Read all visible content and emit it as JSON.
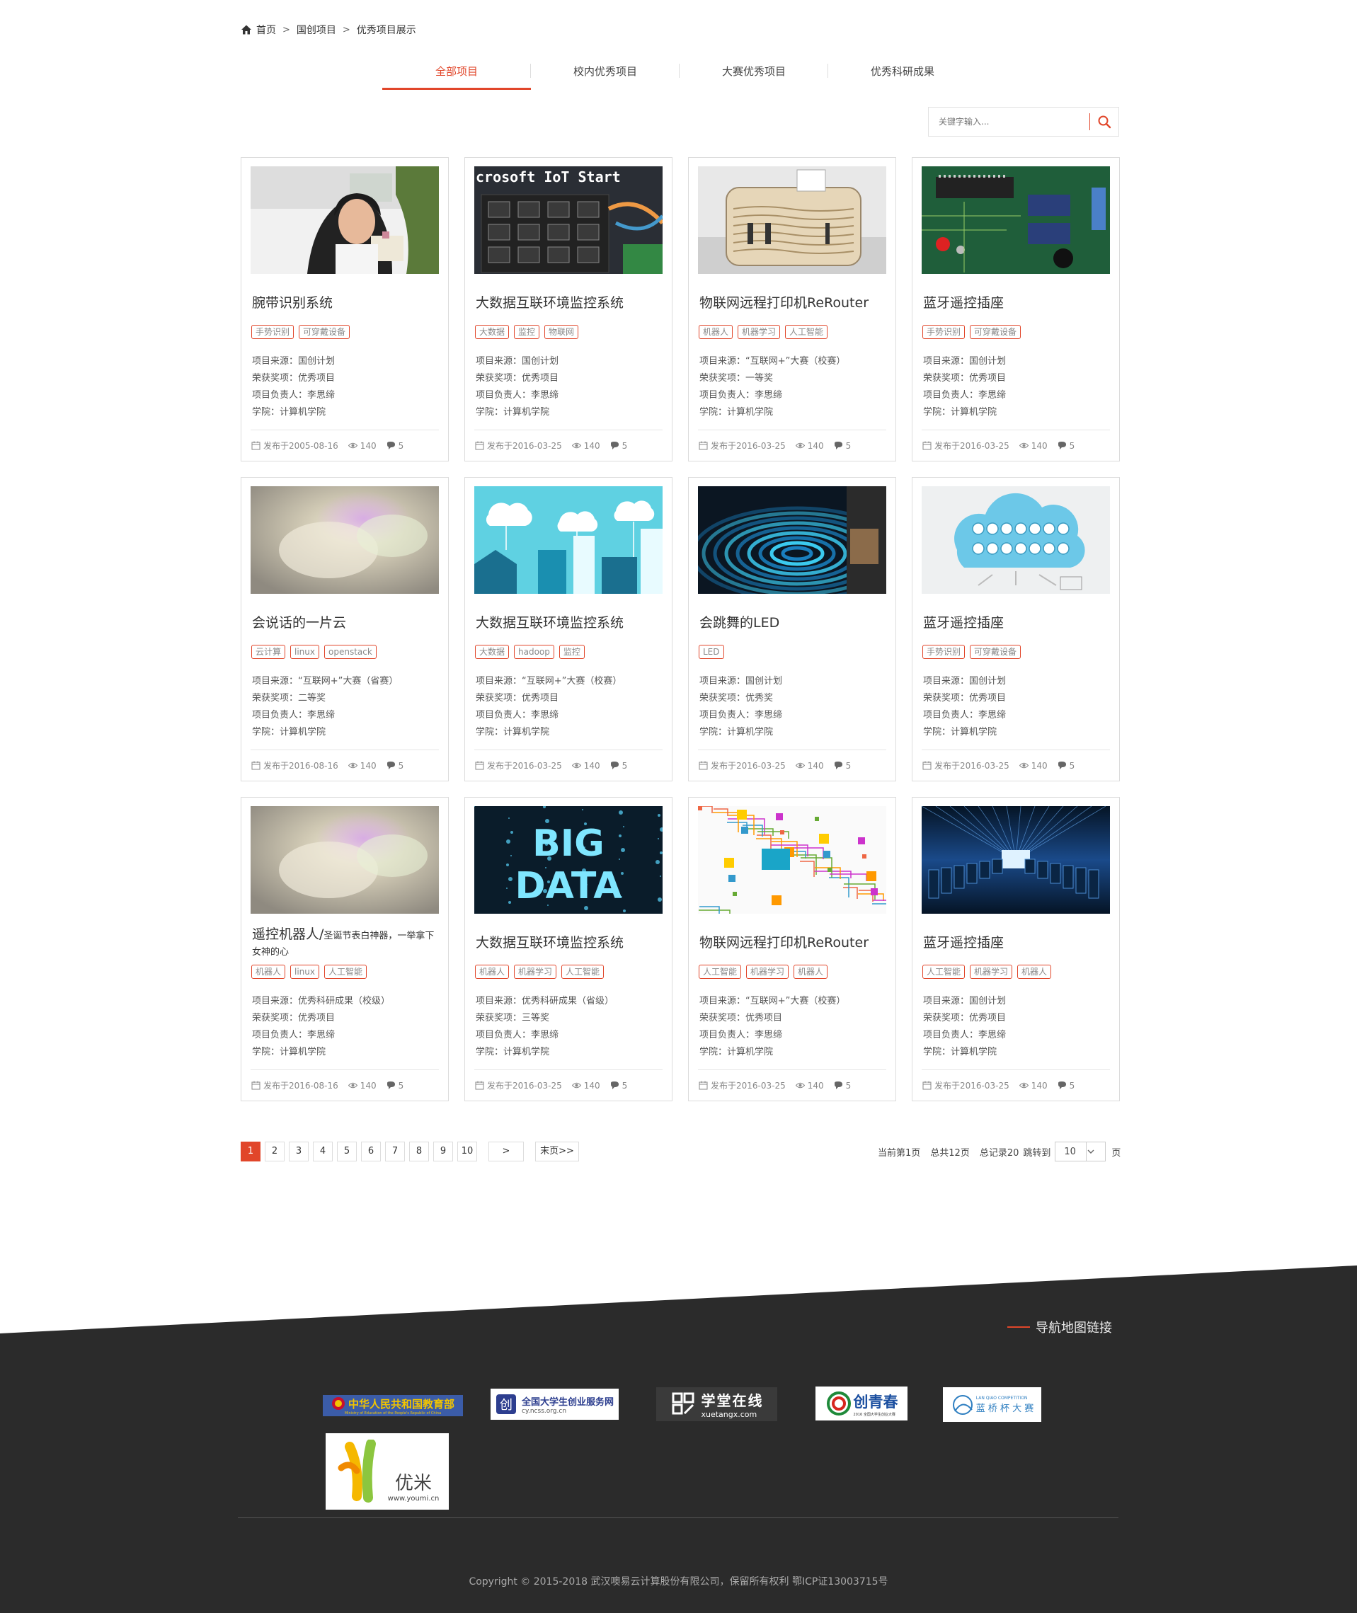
{
  "breadcrumb": {
    "items": [
      "首页",
      "国创项目",
      "优秀项目展示"
    ],
    "sep": ">"
  },
  "tabs": [
    "全部项目",
    "校内优秀项目",
    "大赛优秀项目",
    "优秀科研成果"
  ],
  "search": {
    "placeholder": "关键字输入..."
  },
  "labels": {
    "source": "项目来源：",
    "award": "荣获奖项：",
    "owner": "项目负责人：",
    "college": "学院："
  },
  "cards": [
    {
      "title": "腕带识别系统",
      "tags": [
        "手势识别",
        "可穿戴设备"
      ],
      "source": "国创计划",
      "award": "优秀项目",
      "owner": "李思缔",
      "college": "计算机学院",
      "date": "发布于2005-08-16",
      "views": "140",
      "comments": "5",
      "image": "woman-photo"
    },
    {
      "title": "大数据互联环境监控系统",
      "tags": [
        "大数据",
        "监控",
        "物联网"
      ],
      "source": "国创计划",
      "award": "优秀项目",
      "owner": "李思缔",
      "college": "计算机学院",
      "date": "发布于2016-03-25",
      "views": "140",
      "comments": "5",
      "image": "iot-board"
    },
    {
      "title": "物联网远程打印机ReRouter",
      "tags": [
        "机器人",
        "机器学习",
        "人工智能"
      ],
      "source": "“互联网+”大赛（校赛）",
      "award": "一等奖",
      "owner": "李思缔",
      "college": "计算机学院",
      "date": "发布于2016-03-25",
      "views": "140",
      "comments": "5",
      "image": "printer"
    },
    {
      "title": "蓝牙遥控插座",
      "tags": [
        "手势识别",
        "可穿戴设备"
      ],
      "source": "国创计划",
      "award": "优秀项目",
      "owner": "李思缔",
      "college": "计算机学院",
      "date": "发布于2016-03-25",
      "views": "140",
      "comments": "5",
      "image": "circuit-board"
    },
    {
      "title": "会说话的一片云",
      "tags": [
        "云计算",
        "linux",
        "openstack"
      ],
      "source": "“互联网+”大赛（省赛）",
      "award": "二等奖",
      "owner": "李思缔",
      "college": "计算机学院",
      "date": "发布于2016-08-16",
      "views": "140",
      "comments": "5",
      "image": "cloud-lamp"
    },
    {
      "title": "大数据互联环境监控系统",
      "tags": [
        "大数据",
        "hadoop",
        "监控"
      ],
      "source": "“互联网+”大赛（校赛）",
      "award": "优秀项目",
      "owner": "李思缔",
      "college": "计算机学院",
      "date": "发布于2016-03-25",
      "views": "140",
      "comments": "5",
      "image": "cloud-city"
    },
    {
      "title": "会跳舞的LED",
      "tags": [
        "LED"
      ],
      "source": "国创计划",
      "award": "优秀奖",
      "owner": "李思缔",
      "college": "计算机学院",
      "date": "发布于2016-03-25",
      "views": "140",
      "comments": "5",
      "image": "led-rings"
    },
    {
      "title": "蓝牙遥控插座",
      "tags": [
        "手势识别",
        "可穿戴设备"
      ],
      "source": "国创计划",
      "award": "优秀项目",
      "owner": "李思缔",
      "college": "计算机学院",
      "date": "发布于2016-03-25",
      "views": "140",
      "comments": "5",
      "image": "cloud-icons"
    },
    {
      "title": "遥控机器人/",
      "title_sub": "圣诞节表白神器，一举拿下女神的心",
      "tags": [
        "机器人",
        "linux",
        "人工智能"
      ],
      "source": "优秀科研成果（校级）",
      "award": "优秀项目",
      "owner": "李思缔",
      "college": "计算机学院",
      "date": "发布于2016-08-16",
      "views": "140",
      "comments": "5",
      "image": "cloud-lamp"
    },
    {
      "title": "大数据互联环境监控系统",
      "tags": [
        "机器人",
        "机器学习",
        "人工智能"
      ],
      "source": "优秀科研成果（省级）",
      "award": "三等奖",
      "owner": "李思缔",
      "college": "计算机学院",
      "date": "发布于2016-03-25",
      "views": "140",
      "comments": "5",
      "image": "big-data"
    },
    {
      "title": "物联网远程打印机ReRouter",
      "tags": [
        "人工智能",
        "机器学习",
        "机器人"
      ],
      "source": "“互联网+”大赛（校赛）",
      "award": "优秀项目",
      "owner": "李思缔",
      "college": "计算机学院",
      "date": "发布于2016-03-25",
      "views": "140",
      "comments": "5",
      "image": "network-map"
    },
    {
      "title": "蓝牙遥控插座",
      "tags": [
        "人工智能",
        "机器学习",
        "机器人"
      ],
      "source": "国创计划",
      "award": "优秀项目",
      "owner": "李思缔",
      "college": "计算机学院",
      "date": "发布于2016-03-25",
      "views": "140",
      "comments": "5",
      "image": "server-tunnel"
    }
  ],
  "pagination": {
    "pages": [
      "1",
      "2",
      "3",
      "4",
      "5",
      "6",
      "7",
      "8",
      "9",
      "10"
    ],
    "current": "1",
    "next": ">",
    "last": "末页>>",
    "current_text": "当前第1页",
    "total_pages": "总共12页",
    "total_records": "总记录20",
    "jump_label": "跳转到",
    "jump_value": "10",
    "page_suffix": "页"
  },
  "footer": {
    "nav_title": "导航地图链接",
    "logos": [
      {
        "name": "moe",
        "text": "中华人民共和国教育部",
        "sub": "Ministry of Education of the People's Republic of China"
      },
      {
        "name": "ncss",
        "text": "全国大学生创业服务网",
        "sub": "cy.ncss.org.cn"
      },
      {
        "name": "xuetangx",
        "text": "学堂在线",
        "sub": "xuetangx.com"
      },
      {
        "name": "chuangqingchun",
        "text": "创青春",
        "sub": "2016 全国大学生创业大赛"
      },
      {
        "name": "lanqiao",
        "text": "蓝 桥 杯 大 赛",
        "sub": "LAN QIAO COMPETITION"
      },
      {
        "name": "youmi",
        "text": "优米",
        "sub": "www.youmi.cn"
      }
    ],
    "copyright": "Copyright © 2015-2018 武汉噢易云计算股份有限公司，保留所有权利 鄂ICP证13003715号"
  },
  "colors": {
    "accent": "#e1462a",
    "footer_bg": "#2b2b2b"
  }
}
